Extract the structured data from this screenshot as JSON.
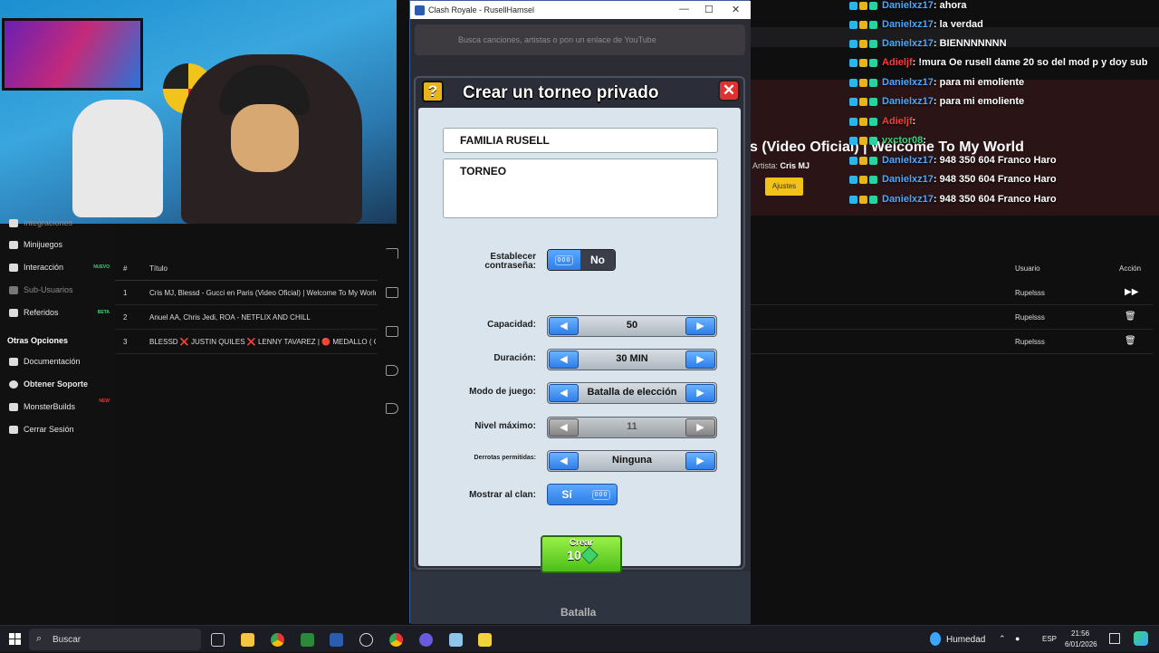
{
  "clash_window": {
    "title": "Clash Royale - RusellHamsel",
    "controls": [
      "—",
      "☐",
      "✕"
    ],
    "bg_search_text": "Busca canciones, artistas o pon un enlace de YouTube",
    "bottom_tab": "Batalla"
  },
  "dialog": {
    "title": "Crear un torneo privado",
    "help": "?",
    "close": "✕",
    "name_field": "FAMILIA RUSELL",
    "description_field": "TORNEO",
    "password_label_1": "Establecer",
    "password_label_2": "contraseña:",
    "password_pill": "000",
    "password_value": "No",
    "options": [
      {
        "label": "Capacidad:",
        "value": "50"
      },
      {
        "label": "Duración:",
        "value": "30 MIN"
      },
      {
        "label": "Modo de juego:",
        "value": "Batalla de elección"
      },
      {
        "label": "Nivel máximo:",
        "value": "11"
      },
      {
        "label": "Derrotas permitidas:",
        "value": "Ninguna"
      }
    ],
    "show_clan_label": "Mostrar al clan:",
    "show_clan_value": "Sí",
    "show_clan_pill": "000",
    "create_label": "Crear",
    "create_cost": "10"
  },
  "left_nav": {
    "items": [
      {
        "label": "Integraciones",
        "icon": "puzzle-icon"
      },
      {
        "label": "Minijuegos",
        "icon": "gamepad-icon"
      },
      {
        "label": "Interacción",
        "icon": "music-icon",
        "tag": "NUEVO"
      },
      {
        "label": "Sub-Usuarios",
        "icon": "users-icon"
      },
      {
        "label": "Referidos",
        "icon": "users-icon",
        "tag": "BETA"
      }
    ],
    "section": "Otras Opciones",
    "other": [
      {
        "label": "Documentación",
        "icon": "book-icon"
      },
      {
        "label": "Obtener Soporte",
        "icon": "help-icon"
      },
      {
        "label": "MonsterBuilds",
        "icon": "monitor-icon",
        "tag": "NEW"
      },
      {
        "label": "Cerrar Sesión",
        "icon": "logout-icon"
      }
    ]
  },
  "song_table": {
    "col_num": "#",
    "col_title": "Título",
    "col_user": "Usuario",
    "col_action": "Acción",
    "rows": [
      {
        "n": "1",
        "title": "Cris MJ, Blessd - Gucci en Paris (Video Oficial) | Welcome To My World",
        "user": "Rupelsss",
        "action": "▶▶"
      },
      {
        "n": "2",
        "title": "Anuel AA, Chris Jedi, ROA - NETFLIX AND CHILL",
        "user": "Rupelsss",
        "action": "🗑"
      },
      {
        "n": "3",
        "title": "BLESSD ❌ JUSTIN QUILES ❌ LENNY TAVAREZ | 🔴 MEDALLO ( OFFI",
        "user": "Rupelsss",
        "action": "🗑"
      }
    ]
  },
  "now_playing": {
    "title": "s (Video Oficial) | Welcome To My World",
    "artist_label": "Artista:",
    "artist": "Cris MJ",
    "button": "Ajustes"
  },
  "chat": [
    {
      "user": "Danielxz17",
      "msg": ": ahora",
      "color": "#4aa8ff"
    },
    {
      "user": "Danielxz17",
      "msg": ": la verdad",
      "color": "#4aa8ff"
    },
    {
      "user": "Danielxz17",
      "msg": ": BIENNNNNNN",
      "color": "#4aa8ff"
    },
    {
      "user": "Adieljf",
      "msg": ": !mura Oe rusell dame 20 so del mod p y doy sub",
      "color": "#ff3a3a"
    },
    {
      "user": "Danielxz17",
      "msg": ": para mi emoliente",
      "color": "#4aa8ff"
    },
    {
      "user": "Danielxz17",
      "msg": ": para mi emoliente",
      "color": "#4aa8ff"
    },
    {
      "user": "Adieljf",
      "msg": ": ",
      "color": "#ff3a3a"
    },
    {
      "user": "vxctor08",
      "msg": ": ",
      "color": "#35d27a"
    },
    {
      "user": "Danielxz17",
      "msg": ": 948 350 604 Franco Haro",
      "color": "#4aa8ff"
    },
    {
      "user": "Danielxz17",
      "msg": ": 948 350 604 Franco Haro",
      "color": "#4aa8ff"
    },
    {
      "user": "Danielxz17",
      "msg": ": 948 350 604 Franco Haro",
      "color": "#4aa8ff"
    }
  ],
  "taskbar": {
    "search_placeholder": "Buscar",
    "weather": "Humedad",
    "lang": "ESP",
    "time": "21:56",
    "date": "6/01/2026"
  }
}
